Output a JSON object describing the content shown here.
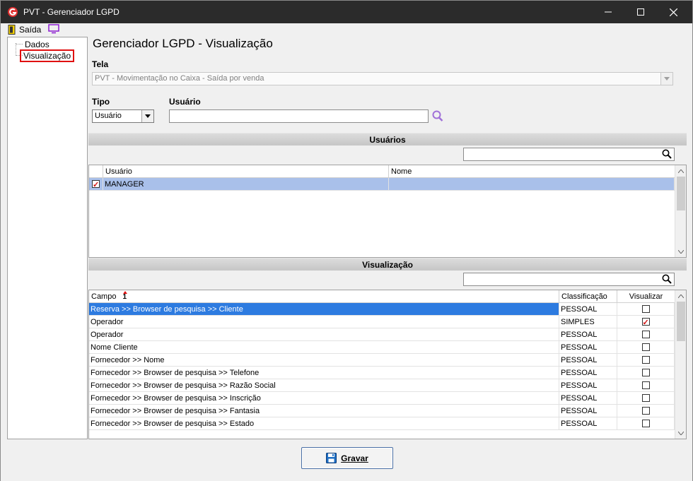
{
  "window": {
    "title": "PVT - Gerenciador LGPD"
  },
  "toolbar": {
    "exit_label": "Saída"
  },
  "tree": {
    "items": [
      {
        "label": "Dados"
      },
      {
        "label": "Visualização"
      }
    ]
  },
  "main": {
    "heading": "Gerenciador LGPD - Visualização",
    "tela_label": "Tela",
    "tela_value": "PVT - Movimentação no Caixa - Saída por venda",
    "tipo_label": "Tipo",
    "tipo_value": "Usuário",
    "usuario_label": "Usuário",
    "usuario_value": ""
  },
  "users": {
    "section_title": "Usuários",
    "filter_value": "",
    "columns": [
      "Usuário",
      "Nome"
    ],
    "rows": [
      {
        "checked": true,
        "usuario": "MANAGER",
        "nome": ""
      }
    ]
  },
  "visual": {
    "section_title": "Visualização",
    "filter_value": "",
    "columns": [
      "Campo",
      "Classificação",
      "Visualizar"
    ],
    "sort_indicator": "1",
    "rows": [
      {
        "campo": "Reserva >> Browser de pesquisa >> Cliente",
        "class": "PESSOAL",
        "visualizar": false
      },
      {
        "campo": "Operador",
        "class": "SIMPLES",
        "visualizar": true
      },
      {
        "campo": "Operador",
        "class": "PESSOAL",
        "visualizar": false
      },
      {
        "campo": "Nome Cliente",
        "class": "PESSOAL",
        "visualizar": false
      },
      {
        "campo": "Fornecedor >> Nome",
        "class": "PESSOAL",
        "visualizar": false
      },
      {
        "campo": "Fornecedor >> Browser de pesquisa >> Telefone",
        "class": "PESSOAL",
        "visualizar": false
      },
      {
        "campo": "Fornecedor >> Browser de pesquisa >> Razão Social",
        "class": "PESSOAL",
        "visualizar": false
      },
      {
        "campo": "Fornecedor >> Browser de pesquisa >> Inscrição",
        "class": "PESSOAL",
        "visualizar": false
      },
      {
        "campo": "Fornecedor >> Browser de pesquisa >> Fantasia",
        "class": "PESSOAL",
        "visualizar": false
      },
      {
        "campo": "Fornecedor >> Browser de pesquisa >> Estado",
        "class": "PESSOAL",
        "visualizar": false
      }
    ]
  },
  "footer": {
    "save_label": "Gravar"
  },
  "colors": {
    "titlebar": "#2b2b2b",
    "row_selected": "#2d7be0",
    "row_highlight": "#a9c0ea",
    "accent_red": "#e01010",
    "search_purple": "#a070d8"
  }
}
